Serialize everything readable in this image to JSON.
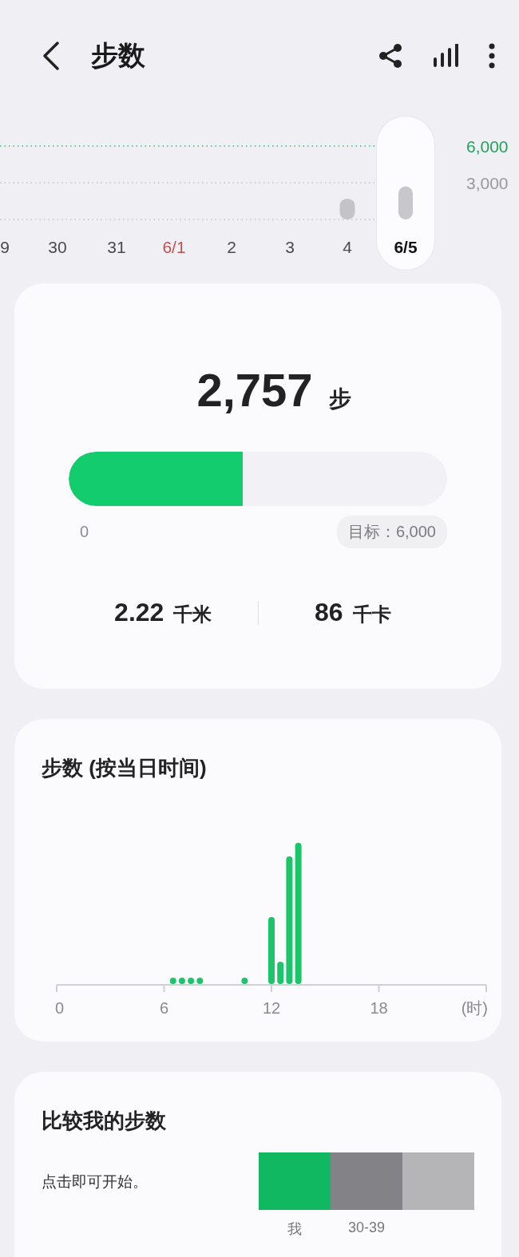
{
  "header": {
    "title": "步数"
  },
  "week_chart": {
    "days": [
      {
        "selected": false,
        "color": "#4a4a4e"
      },
      {
        "selected": false,
        "color": "#4a4a4e"
      },
      {
        "selected": false,
        "color": "#4a4a4e"
      },
      {
        "selected": false,
        "color": "#c0504d"
      },
      {
        "selected": false,
        "color": "#4a4a4e"
      },
      {
        "selected": false,
        "color": "#4a4a4e"
      },
      {
        "selected": false,
        "color": "#4a4a4e"
      },
      {
        "selected": true,
        "color": "#111111"
      }
    ],
    "chart_data": {
      "type": "bar",
      "categories": [
        "9",
        "30",
        "31",
        "6/1",
        "2",
        "3",
        "4",
        "6/5"
      ],
      "values": [
        null,
        null,
        null,
        null,
        null,
        null,
        1700,
        2700
      ],
      "ylim": [
        0,
        6000
      ],
      "yticks": [
        {
          "value": 3000,
          "label": "3,000"
        },
        {
          "value": 6000,
          "label": "6,000"
        }
      ]
    }
  },
  "summary": {
    "steps": "2,757",
    "steps_unit": "步",
    "level": 0.46,
    "min_label": "0",
    "goal_label": "目标：6,000",
    "distance": "2.22",
    "distance_unit": "千米",
    "calories": "86",
    "calories_unit": "千卡"
  },
  "hourly": {
    "title": "步数 (按当日时间)",
    "x_labels": [
      "0",
      "6",
      "12",
      "18",
      "(时)"
    ]
  },
  "compare": {
    "title": "比较我的步数",
    "hint": "点击即可开始。",
    "segments": [
      {
        "label": "我",
        "color": "#10b862"
      },
      {
        "label": "30-39",
        "color": "#838287"
      }
    ]
  }
}
